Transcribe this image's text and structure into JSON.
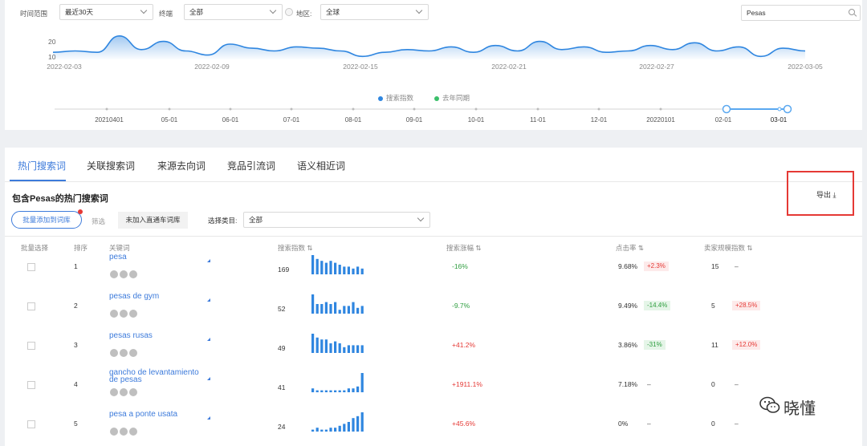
{
  "filters": {
    "time_label": "时间范围",
    "time_value": "最近30天",
    "terminal_label": "终端",
    "terminal_value": "全部",
    "region_label": "地区",
    "region_value": "全球",
    "search_value": "Pesas"
  },
  "trend_chart": {
    "y_ticks": [
      "20",
      "10"
    ],
    "x_ticks": [
      "2022-02-03",
      "2022-02-09",
      "2022-02-15",
      "2022-02-21",
      "2022-02-27",
      "2022-03-05"
    ],
    "legend": [
      {
        "label": "搜索指数",
        "color": "#2f86e0"
      },
      {
        "label": "去年同期",
        "color": "#3bbf6a"
      }
    ],
    "series_values": [
      12,
      13,
      12,
      24,
      14,
      20,
      13,
      10,
      18,
      15,
      13,
      16,
      15,
      13,
      9,
      12,
      14,
      13,
      16,
      12,
      17,
      13,
      20,
      14,
      16,
      12,
      13,
      17,
      14,
      19,
      13,
      16,
      9,
      15,
      13
    ],
    "timeline_labels": [
      "20210401",
      "05-01",
      "06-01",
      "07-01",
      "08-01",
      "09-01",
      "10-01",
      "11-01",
      "12-01",
      "20220101",
      "02-01",
      "03-01"
    ]
  },
  "tabs": [
    {
      "label": "热门搜索词",
      "active": true
    },
    {
      "label": "关联搜索词",
      "active": false
    },
    {
      "label": "来源去向词",
      "active": false
    },
    {
      "label": "竞品引流词",
      "active": false
    },
    {
      "label": "语义相近词",
      "active": false
    }
  ],
  "section": {
    "title": "包含Pesas的热门搜索词",
    "export_label": "导出"
  },
  "toolbar": {
    "batch_add": "批量添加到词库",
    "filter": "筛选",
    "not_added": "未加入直通车词库",
    "category_label": "选择类目:",
    "category_value": "全部"
  },
  "table": {
    "headers": [
      "批量选择",
      "排序",
      "关键词",
      "搜索指数 ⇅",
      "搜索涨幅 ⇅",
      "点击率 ⇅",
      "卖家规模指数 ⇅"
    ],
    "rows": [
      {
        "rank": "1",
        "keyword": "pesa",
        "search_index": "169",
        "spark": [
          10,
          8,
          7,
          6,
          7,
          6,
          5,
          4,
          4,
          3,
          4,
          3
        ],
        "growth": "-16%",
        "growth_dir": "down",
        "ctr": "9.68%",
        "ctr_change": "+2.3%",
        "ctr_dir": "up",
        "sellers": "15",
        "seller_change": "–",
        "seller_dir": "none"
      },
      {
        "rank": "2",
        "keyword": "pesas de gym",
        "search_index": "52",
        "spark": [
          10,
          5,
          5,
          6,
          5,
          6,
          2,
          4,
          4,
          6,
          3,
          4
        ],
        "growth": "-9.7%",
        "growth_dir": "down",
        "ctr": "9.49%",
        "ctr_change": "-14.4%",
        "ctr_dir": "down",
        "sellers": "5",
        "seller_change": "+28.5%",
        "seller_dir": "up"
      },
      {
        "rank": "3",
        "keyword": "pesas rusas",
        "search_index": "49",
        "spark": [
          10,
          8,
          7,
          7,
          5,
          6,
          5,
          3,
          4,
          4,
          4,
          4
        ],
        "growth": "+41.2%",
        "growth_dir": "up",
        "ctr": "3.86%",
        "ctr_change": "-31%",
        "ctr_dir": "down",
        "sellers": "11",
        "seller_change": "+12.0%",
        "seller_dir": "up"
      },
      {
        "rank": "4",
        "keyword": "gancho de levantamiento de pesas",
        "search_index": "41",
        "spark": [
          2,
          1,
          1,
          1,
          1,
          1,
          1,
          1,
          2,
          2,
          3,
          10
        ],
        "growth": "+1911.1%",
        "growth_dir": "up",
        "ctr": "7.18%",
        "ctr_change": "–",
        "ctr_dir": "none",
        "sellers": "0",
        "seller_change": "–",
        "seller_dir": "none"
      },
      {
        "rank": "5",
        "keyword": "pesa a ponte usata",
        "search_index": "24",
        "spark": [
          1,
          2,
          1,
          1,
          2,
          2,
          3,
          4,
          5,
          7,
          8,
          10
        ],
        "growth": "+45.6%",
        "growth_dir": "up",
        "ctr": "0%",
        "ctr_change": "–",
        "ctr_dir": "none",
        "sellers": "0",
        "seller_change": "–",
        "seller_dir": "none"
      }
    ]
  },
  "watermark": {
    "text": "晓懂"
  }
}
